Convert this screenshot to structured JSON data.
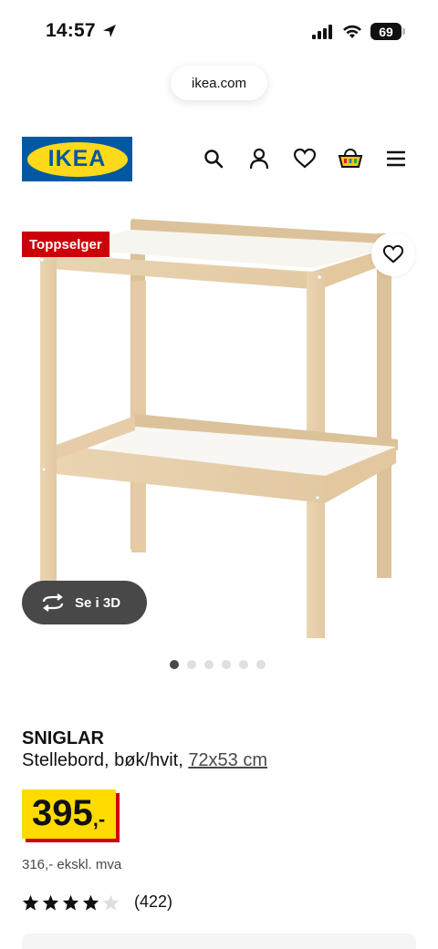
{
  "status_bar": {
    "time": "14:57",
    "battery": "69"
  },
  "browser": {
    "url": "ikea.com"
  },
  "header": {
    "logo_text": "IKEA",
    "icons": [
      "search-icon",
      "user-icon",
      "heart-icon",
      "basket-icon",
      "menu-icon"
    ]
  },
  "gallery": {
    "badge": "Toppselger",
    "view_3d_label": "Se i 3D",
    "image_count": 6,
    "active_index": 0
  },
  "product": {
    "name": "SNIGLAR",
    "description": "Stellebord, bøk/hvit, ",
    "size": "72x53 cm",
    "price": "395",
    "price_suffix": ",-",
    "price_ex_vat": "316,- ekskl. mva",
    "rating_value": 4,
    "rating_max": 5,
    "review_count": "(422)"
  },
  "colors": {
    "ikea_blue": "#0058a3",
    "ikea_yellow": "#ffda1a",
    "badge_red": "#cc0008",
    "price_yellow": "#ffdb00"
  }
}
